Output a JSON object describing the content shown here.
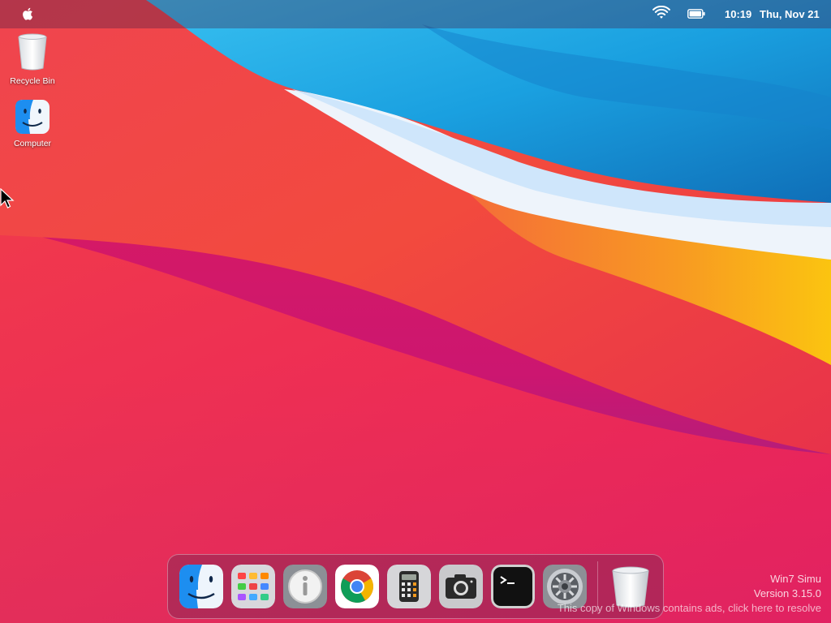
{
  "menubar": {
    "apple_icon": "apple-logo-icon",
    "wifi_icon": "wifi-icon",
    "battery_icon": "battery-icon",
    "time": "10:19",
    "date": "Thu, Nov 21"
  },
  "desktop": {
    "icons": [
      {
        "label": "Recycle Bin",
        "icon": "recycle-bin-icon"
      },
      {
        "label": "Computer",
        "icon": "finder-icon"
      }
    ]
  },
  "dock": {
    "items": [
      {
        "name": "finder",
        "icon": "finder-icon"
      },
      {
        "name": "launchpad",
        "icon": "launchpad-icon"
      },
      {
        "name": "info",
        "icon": "info-icon"
      },
      {
        "name": "chrome",
        "icon": "chrome-icon"
      },
      {
        "name": "calculator",
        "icon": "calculator-icon"
      },
      {
        "name": "camera",
        "icon": "camera-icon"
      },
      {
        "name": "terminal",
        "icon": "terminal-icon"
      },
      {
        "name": "system-preferences",
        "icon": "gear-icon"
      },
      {
        "name": "trash",
        "icon": "trash-icon"
      }
    ]
  },
  "watermark": {
    "product": "Win7 Simu",
    "version": "Version 3.15.0",
    "notice": "This copy of Windows contains ads, click here to resolve"
  },
  "colors": {
    "wallpaper_red": "#e8324a",
    "wallpaper_blue": "#1a8fd6",
    "wallpaper_orange": "#f7a21b",
    "wallpaper_magenta": "#c81a6e"
  }
}
